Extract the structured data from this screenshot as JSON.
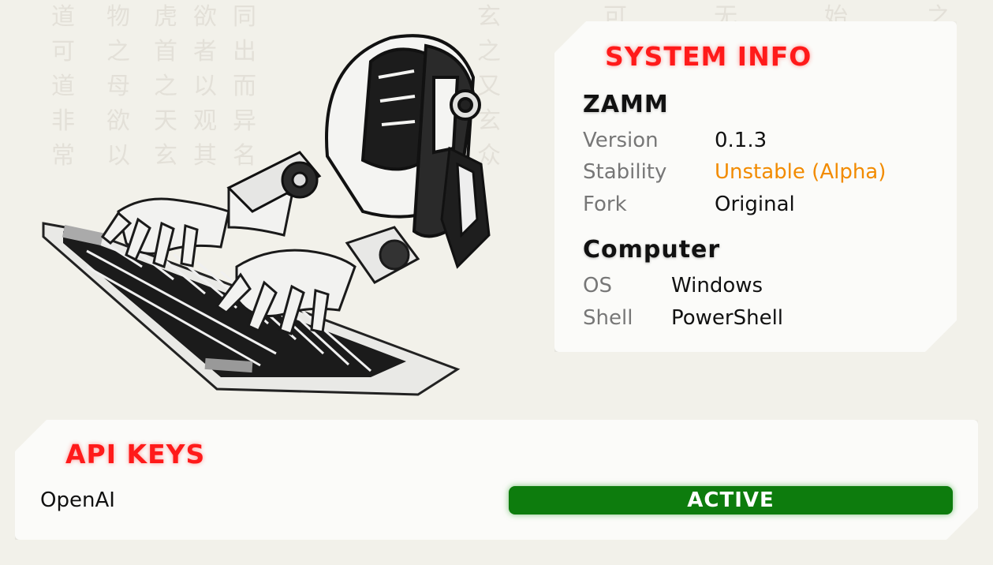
{
  "system_info": {
    "title": "SYSTEM INFO",
    "zamm_section": {
      "heading": "ZAMM",
      "rows": [
        {
          "label": "Version",
          "value": "0.1.3"
        },
        {
          "label": "Stability",
          "value": "Unstable (Alpha)"
        },
        {
          "label": "Fork",
          "value": "Original"
        }
      ]
    },
    "computer_section": {
      "heading": "Computer",
      "rows": [
        {
          "label": "OS",
          "value": "Windows"
        },
        {
          "label": "Shell",
          "value": "PowerShell"
        }
      ]
    }
  },
  "api_keys": {
    "title": "API KEYS",
    "entries": [
      {
        "service": "OpenAI",
        "status": "ACTIVE"
      }
    ]
  },
  "colors": {
    "title_red": "#ff1a1a",
    "unstable_orange": "#f28b00",
    "active_green": "#0d7c0d",
    "label_gray": "#777777"
  },
  "icons": {
    "illustration": "robot-typing-illustration"
  }
}
